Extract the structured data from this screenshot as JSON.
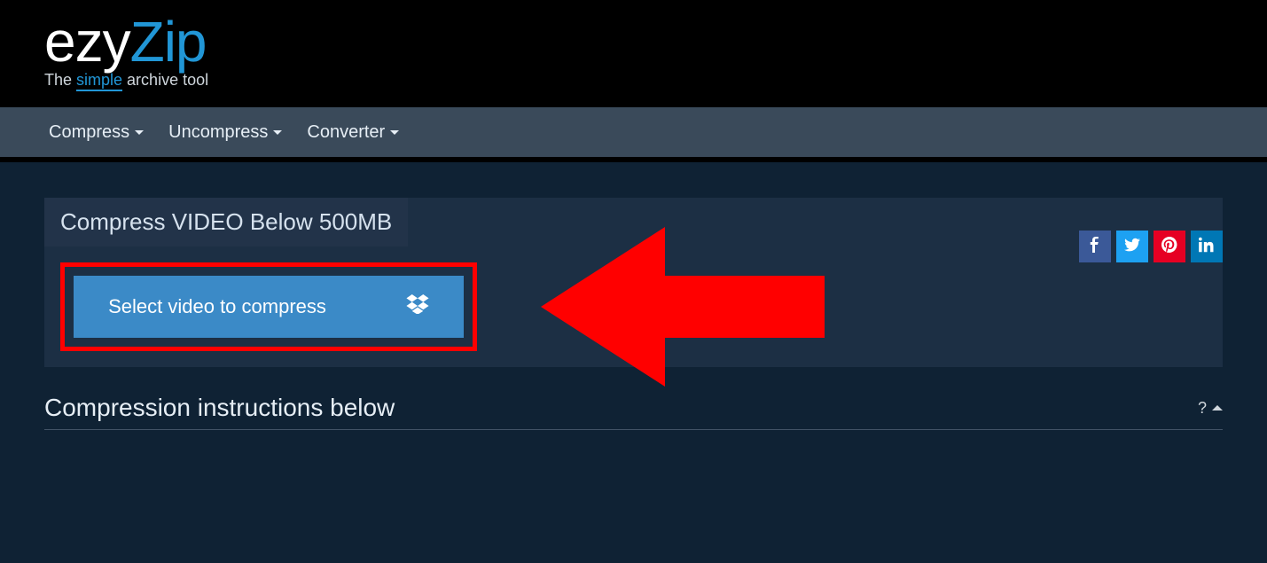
{
  "logo": {
    "part1": "ezy",
    "part2": "Zip"
  },
  "tagline": {
    "prefix": "The ",
    "highlight": "simple",
    "suffix": " archive tool"
  },
  "nav": {
    "compress": "Compress",
    "uncompress": "Uncompress",
    "converter": "Converter"
  },
  "panel": {
    "title": "Compress VIDEO Below 500MB"
  },
  "button": {
    "select_label": "Select video to compress"
  },
  "instructions": {
    "title": "Compression instructions below",
    "help": "?"
  },
  "colors": {
    "accent": "#2196d6",
    "button": "#3b8ac7",
    "highlight": "#ff0000"
  }
}
